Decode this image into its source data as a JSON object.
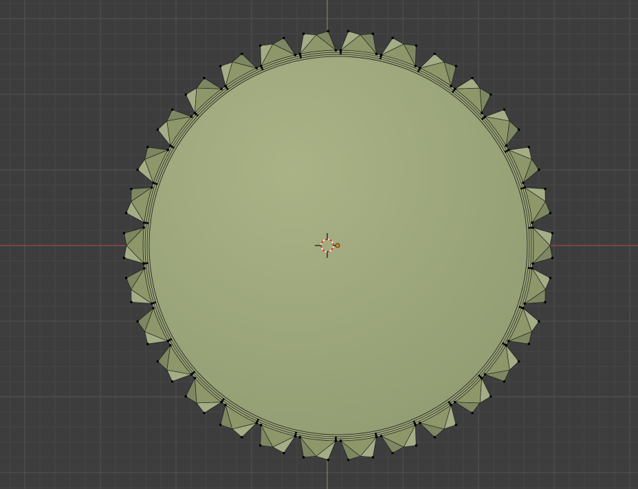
{
  "viewport": {
    "view": "top-orthographic",
    "mode": "edit-mode",
    "colors": {
      "background": "#3d3d3d",
      "grid_minor": "#474747",
      "grid_major": "#525252",
      "axis_x": "#c0454b",
      "axis_y": "#7aa23a",
      "mesh_face": "#9aa57a",
      "mesh_face_center": "#a8b287",
      "tooth_light": "#a4ad86",
      "tooth_dark": "#7d8761",
      "edge": "#1a1a1a",
      "vertex": "#000000",
      "cursor_red": "#e0402a",
      "cursor_white": "#f0f0f0"
    },
    "object": {
      "name_icon": "bottle-cap-mesh",
      "teeth_count": 30,
      "origin_icon": "object-origin-icon"
    },
    "cursor_icon": "3d-cursor-icon"
  }
}
